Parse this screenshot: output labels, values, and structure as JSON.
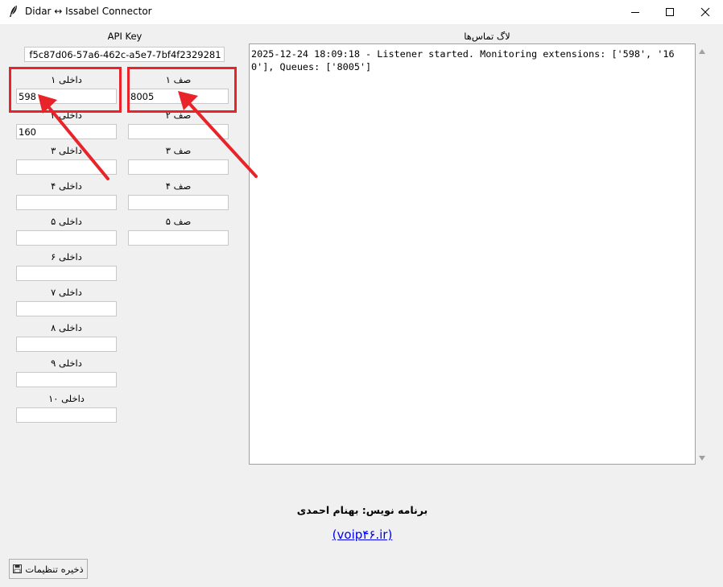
{
  "window": {
    "title": "Didar ↔ Issabel Connector"
  },
  "api_key": {
    "label": "API Key",
    "value": "f5c87d06-57a6-462c-a5e7-7bf4f2329281"
  },
  "extensions": [
    {
      "label": "داخلی ۱",
      "value": "598"
    },
    {
      "label": "داخلی ۲",
      "value": "160"
    },
    {
      "label": "داخلی ۳",
      "value": ""
    },
    {
      "label": "داخلی ۴",
      "value": ""
    },
    {
      "label": "داخلی ۵",
      "value": ""
    },
    {
      "label": "داخلی ۶",
      "value": ""
    },
    {
      "label": "داخلی ۷",
      "value": ""
    },
    {
      "label": "داخلی ۸",
      "value": ""
    },
    {
      "label": "داخلی ۹",
      "value": ""
    },
    {
      "label": "داخلی ۱۰",
      "value": ""
    }
  ],
  "queues": [
    {
      "label": "صف ۱",
      "value": "8005"
    },
    {
      "label": "صف ۲",
      "value": ""
    },
    {
      "label": "صف ۳",
      "value": ""
    },
    {
      "label": "صف ۴",
      "value": ""
    },
    {
      "label": "صف ۵",
      "value": ""
    }
  ],
  "log": {
    "label": "لاگ تماس‌ها",
    "text": "2025-12-24 18:09:18 - Listener started. Monitoring extensions: ['598', '160'], Queues: ['8005']"
  },
  "footer": {
    "credit": "برنامه نویس: بهنام احمدی",
    "link": "(voip۴۶.ir)"
  },
  "save_button": {
    "label": "ذخیره تنظیمات",
    "icon": "floppy-disk-icon"
  },
  "colors": {
    "annotation": "#e8242a",
    "link": "#0000ee",
    "window_bg": "#f0f0f0"
  }
}
